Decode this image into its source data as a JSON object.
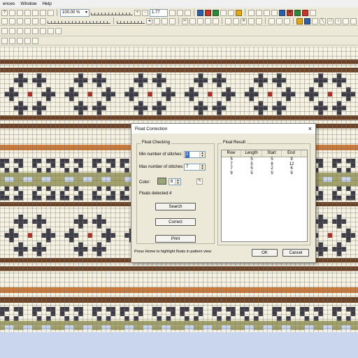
{
  "menubar": {
    "items": [
      "ences",
      "Window",
      "Help"
    ]
  },
  "toolbar": {
    "zoom_value": "100.00 %",
    "ratio_value": "1.77",
    "info_icon": "information-icon"
  },
  "colors": {
    "brown": "#6b3f22",
    "orange": "#cc7a3a",
    "dark": "#3b3a44",
    "olive": "#a3a26a",
    "red": "#a82a22",
    "cream": "#f7f3e3",
    "lightblue": "#c9d6ee",
    "selected_swatch": "#9aa57a"
  },
  "dialog": {
    "title": "Float Correction",
    "float_checking": {
      "title": "Float Checking",
      "min_label": "Min number of stitches:",
      "min_value": "2",
      "max_label": "Max number of stitches:",
      "max_value": "7",
      "color_label": "Color:",
      "color_value": "6",
      "floats_label": "Floats detected:",
      "floats_value": "4",
      "search_label": "Search",
      "correct_label": "Correct",
      "print_label": "Print"
    },
    "float_result": {
      "title": "Float Result",
      "columns": [
        "Row",
        "Length",
        "Start",
        "End"
      ],
      "rows": [
        [
          "5",
          "5",
          "5",
          "9"
        ],
        [
          "7",
          "5",
          "8",
          "12"
        ],
        [
          "7",
          "5",
          "2",
          "6"
        ],
        [
          "9",
          "5",
          "5",
          "9"
        ]
      ]
    },
    "hint": "Press Home to highlight floats in pattern view",
    "ok_label": "OK",
    "cancel_label": "Cancel"
  }
}
